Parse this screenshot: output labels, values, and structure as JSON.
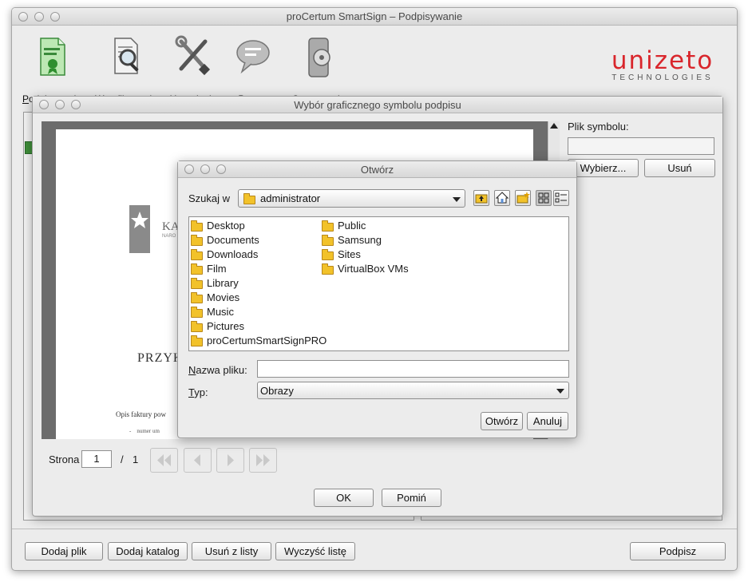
{
  "app": {
    "title": "proCertum SmartSign – Podpisywanie"
  },
  "toolbar": {
    "items": [
      {
        "label": "Podpisywanie",
        "icon": "sign-document-icon"
      },
      {
        "label": "Weryfikowanie",
        "icon": "verify-magnifier-icon"
      },
      {
        "label": "Ustawienia",
        "icon": "tools-icon"
      },
      {
        "label": "Pomoc",
        "icon": "speech-bubble-icon"
      },
      {
        "label": "O programie",
        "icon": "about-disc-icon"
      }
    ]
  },
  "brand": {
    "logo_text": "unizeto",
    "logo_sub": "TECHNOLOGIES",
    "color": "#d9262c"
  },
  "bottom_bar": {
    "add_file": "Dodaj plik",
    "add_folder": "Dodaj katalog",
    "remove_from_list": "Usuń z listy",
    "clear_list": "Wyczyść listę",
    "sign": "Podpisz"
  },
  "symbol_dialog": {
    "title": "Wybór graficznego symbolu podpisu",
    "symbol_file_label": "Plik symbolu:",
    "symbol_file_value": "",
    "choose_button": "Wybierz...",
    "remove_button": "Usuń",
    "page_label": "Strona",
    "page_value": "1",
    "page_separator": "/",
    "page_total": "1",
    "ok_button": "OK",
    "skip_button": "Pomiń",
    "document_preview": {
      "header_fragment": "KA",
      "header_sub_fragment": "NARO",
      "heading_fragment": "PRZYK",
      "line1": "Opis faktury pow",
      "line2": "numer um"
    }
  },
  "open_dialog": {
    "title": "Otwórz",
    "look_in_label": "Szukaj w",
    "look_in_value": "administrator",
    "toolbar_icons": [
      "up-folder-icon",
      "home-icon",
      "new-folder-icon",
      "list-view-icon",
      "details-view-icon"
    ],
    "files_col1": [
      "Desktop",
      "Documents",
      "Downloads",
      "Film",
      "Library",
      "Movies",
      "Music",
      "Pictures",
      "proCertumSmartSignPRO"
    ],
    "files_col2": [
      "Public",
      "Samsung",
      "Sites",
      "VirtualBox VMs"
    ],
    "filename_label": "Nazwa pliku:",
    "filename_value": "",
    "type_label": "Typ:",
    "type_value": "Obrazy",
    "open_button": "Otwórz",
    "cancel_button": "Anuluj"
  }
}
